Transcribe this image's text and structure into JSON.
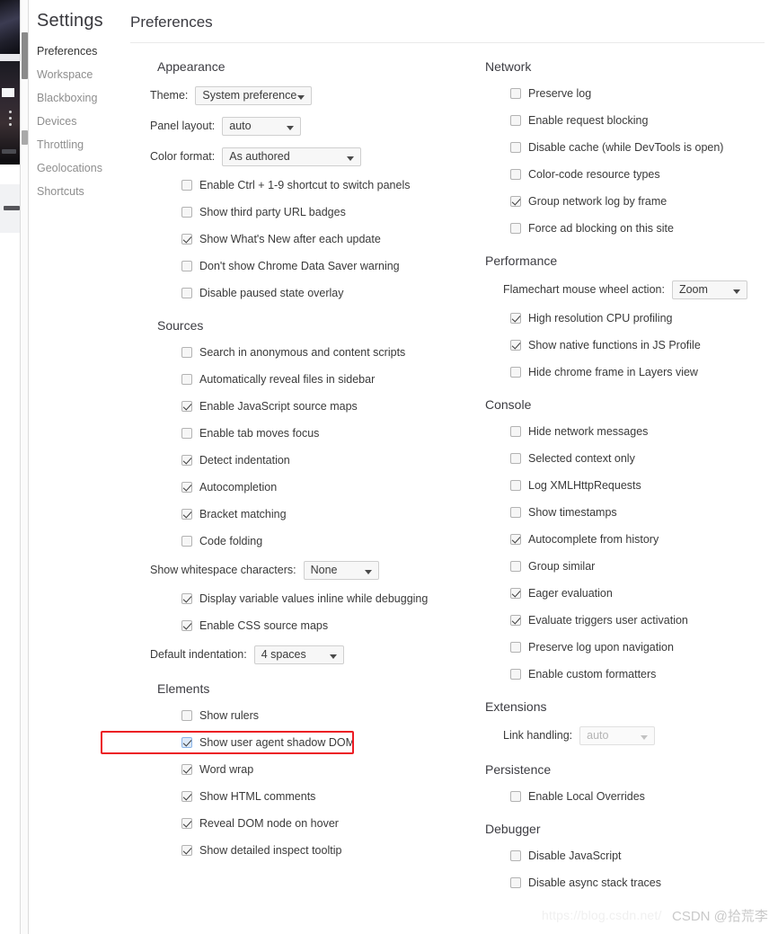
{
  "window": {
    "settings_title": "Settings",
    "content_title": "Preferences"
  },
  "sidebar": {
    "items": [
      {
        "label": "Preferences",
        "selected": true
      },
      {
        "label": "Workspace",
        "selected": false
      },
      {
        "label": "Blackboxing",
        "selected": false
      },
      {
        "label": "Devices",
        "selected": false
      },
      {
        "label": "Throttling",
        "selected": false
      },
      {
        "label": "Geolocations",
        "selected": false
      },
      {
        "label": "Shortcuts",
        "selected": false
      }
    ]
  },
  "left_column": {
    "appearance": {
      "title": "Appearance",
      "theme": {
        "label": "Theme:",
        "value": "System preference"
      },
      "panel_layout": {
        "label": "Panel layout:",
        "value": "auto"
      },
      "color_format": {
        "label": "Color format:",
        "value": "As authored"
      },
      "checkboxes": [
        {
          "label": "Enable Ctrl + 1-9 shortcut to switch panels",
          "checked": false
        },
        {
          "label": "Show third party URL badges",
          "checked": false
        },
        {
          "label": "Show What's New after each update",
          "checked": true
        },
        {
          "label": "Don't show Chrome Data Saver warning",
          "checked": false
        },
        {
          "label": "Disable paused state overlay",
          "checked": false
        }
      ]
    },
    "sources": {
      "title": "Sources",
      "checkboxes_top": [
        {
          "label": "Search in anonymous and content scripts",
          "checked": false
        },
        {
          "label": "Automatically reveal files in sidebar",
          "checked": false
        },
        {
          "label": "Enable JavaScript source maps",
          "checked": true
        },
        {
          "label": "Enable tab moves focus",
          "checked": false
        },
        {
          "label": "Detect indentation",
          "checked": true
        },
        {
          "label": "Autocompletion",
          "checked": true
        },
        {
          "label": "Bracket matching",
          "checked": true
        },
        {
          "label": "Code folding",
          "checked": false
        }
      ],
      "whitespace": {
        "label": "Show whitespace characters:",
        "value": "None"
      },
      "checkboxes_bottom": [
        {
          "label": "Display variable values inline while debugging",
          "checked": true
        },
        {
          "label": "Enable CSS source maps",
          "checked": true
        }
      ],
      "default_indentation": {
        "label": "Default indentation:",
        "value": "4 spaces"
      }
    },
    "elements": {
      "title": "Elements",
      "checkboxes": [
        {
          "label": "Show rulers",
          "checked": false,
          "highlighted": false
        },
        {
          "label": "Show user agent shadow DOM",
          "checked": true,
          "highlighted": true
        },
        {
          "label": "Word wrap",
          "checked": true,
          "highlighted": false
        },
        {
          "label": "Show HTML comments",
          "checked": true,
          "highlighted": false
        },
        {
          "label": "Reveal DOM node on hover",
          "checked": true,
          "highlighted": false
        },
        {
          "label": "Show detailed inspect tooltip",
          "checked": true,
          "highlighted": false
        }
      ]
    }
  },
  "right_column": {
    "network": {
      "title": "Network",
      "checkboxes": [
        {
          "label": "Preserve log",
          "checked": false
        },
        {
          "label": "Enable request blocking",
          "checked": false
        },
        {
          "label": "Disable cache (while DevTools is open)",
          "checked": false
        },
        {
          "label": "Color-code resource types",
          "checked": false
        },
        {
          "label": "Group network log by frame",
          "checked": true
        },
        {
          "label": "Force ad blocking on this site",
          "checked": false
        }
      ]
    },
    "performance": {
      "title": "Performance",
      "flamechart": {
        "label": "Flamechart mouse wheel action:",
        "value": "Zoom"
      },
      "checkboxes": [
        {
          "label": "High resolution CPU profiling",
          "checked": true
        },
        {
          "label": "Show native functions in JS Profile",
          "checked": true
        },
        {
          "label": "Hide chrome frame in Layers view",
          "checked": false
        }
      ]
    },
    "console": {
      "title": "Console",
      "checkboxes": [
        {
          "label": "Hide network messages",
          "checked": false
        },
        {
          "label": "Selected context only",
          "checked": false
        },
        {
          "label": "Log XMLHttpRequests",
          "checked": false
        },
        {
          "label": "Show timestamps",
          "checked": false
        },
        {
          "label": "Autocomplete from history",
          "checked": true
        },
        {
          "label": "Group similar",
          "checked": false
        },
        {
          "label": "Eager evaluation",
          "checked": true
        },
        {
          "label": "Evaluate triggers user activation",
          "checked": true
        },
        {
          "label": "Preserve log upon navigation",
          "checked": false
        },
        {
          "label": "Enable custom formatters",
          "checked": false
        }
      ]
    },
    "extensions": {
      "title": "Extensions",
      "link_handling": {
        "label": "Link handling:",
        "value": "auto",
        "disabled": true
      }
    },
    "persistence": {
      "title": "Persistence",
      "checkboxes": [
        {
          "label": "Enable Local Overrides",
          "checked": false
        }
      ]
    },
    "debugger": {
      "title": "Debugger",
      "checkboxes": [
        {
          "label": "Disable JavaScript",
          "checked": false
        },
        {
          "label": "Disable async stack traces",
          "checked": false
        }
      ]
    }
  },
  "watermark": {
    "url": "https://blog.csdn.net/",
    "tag": "CSDN @拾荒李"
  },
  "colors": {
    "highlight_red": "#ec1c24",
    "focus_blue": "#dce9f8",
    "selected_text": "#333333",
    "muted_text": "#8e8e8e"
  }
}
